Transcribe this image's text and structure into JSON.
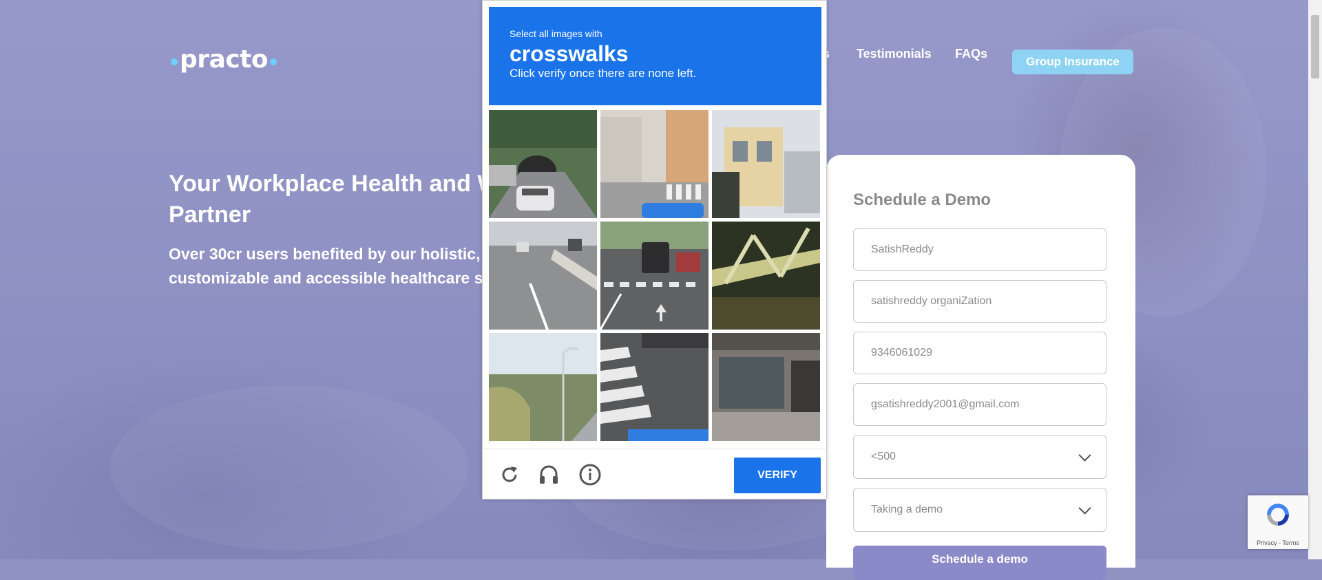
{
  "header": {
    "logo_text": "practo",
    "nav": [
      {
        "label": "s"
      },
      {
        "label": "Testimonials"
      },
      {
        "label": "FAQs"
      }
    ],
    "cta_label": "Group Insurance"
  },
  "hero": {
    "title": "Your Workplace Health and W\nPartner",
    "subtitle": "Over 30cr users benefited by our holistic,\ncustomizable and accessible healthcare s"
  },
  "demo_form": {
    "title": "Schedule a Demo",
    "fields": [
      {
        "value": "SatishReddy"
      },
      {
        "value": " satishreddy organiZation"
      },
      {
        "value": "9346061029"
      },
      {
        "value": "gsatishreddy2001@gmail.com"
      },
      {
        "value": "<500"
      },
      {
        "value": "Taking a demo"
      }
    ],
    "submit_label": "Schedule a demo"
  },
  "captcha": {
    "instruction": "Select all images with",
    "target": "crosswalks",
    "hint": "Click verify once there are none left.",
    "verify_label": "VERIFY",
    "icons": [
      "reload-icon",
      "audio-challenge-icon",
      "info-icon"
    ],
    "tiles": [
      {
        "scene": "highway-tunnel"
      },
      {
        "scene": "street-corner-crosswalk"
      },
      {
        "scene": "house-facade"
      },
      {
        "scene": "highway-lanes"
      },
      {
        "scene": "road-crosswalk-car"
      },
      {
        "scene": "bridge-truss"
      },
      {
        "scene": "roadside-grass-streetlight"
      },
      {
        "scene": "zebra-crossing-closeup"
      },
      {
        "scene": "garage-building"
      }
    ]
  },
  "recaptcha_badge": {
    "text": "Privacy - Terms"
  },
  "colors": {
    "captcha_blue": "#1a73e8",
    "cta": "#8fd3f4",
    "submit": "#8b8ac8",
    "page_bg": "#8f93c2"
  }
}
